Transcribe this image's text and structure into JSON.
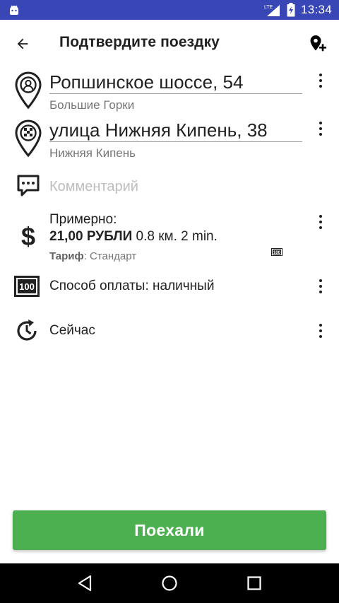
{
  "status_bar": {
    "time": "13:34",
    "network": "LTE",
    "icons": [
      "android-icon",
      "lte-signal-icon",
      "battery-charging-icon"
    ]
  },
  "header": {
    "title": "Подтвердите поездку",
    "back_icon": "arrow-back-icon",
    "add_place_icon": "add-location-icon"
  },
  "route": {
    "from": {
      "address": "Ропшинское шоссе, 54",
      "locality": "Большие Горки",
      "icon": "pickup-pin-icon"
    },
    "to": {
      "address": "улица Нижняя Кипень, 38",
      "locality": "Нижняя Кипень",
      "icon": "destination-flag-pin-icon"
    }
  },
  "comment": {
    "placeholder": "Комментарий",
    "value": "",
    "icon": "comment-icon"
  },
  "fare": {
    "approx_label": "Примерно:",
    "price": "21,00 РУБЛИ",
    "details": "0.8 км. 2 min.",
    "tariff_label": "Тариф",
    "tariff_value": ": Стандарт",
    "icon": "dollar-icon",
    "tariff_icon": "cash-icon"
  },
  "payment": {
    "label": "Способ оплаты: наличный",
    "icon": "cash-icon"
  },
  "schedule": {
    "label": "Сейчас",
    "icon": "schedule-clock-icon"
  },
  "action": {
    "go_label": "Поехали"
  },
  "colors": {
    "status_bar": "#3846b6",
    "accent_green": "#4caf50",
    "text_primary": "#212121",
    "text_secondary": "#757575"
  }
}
